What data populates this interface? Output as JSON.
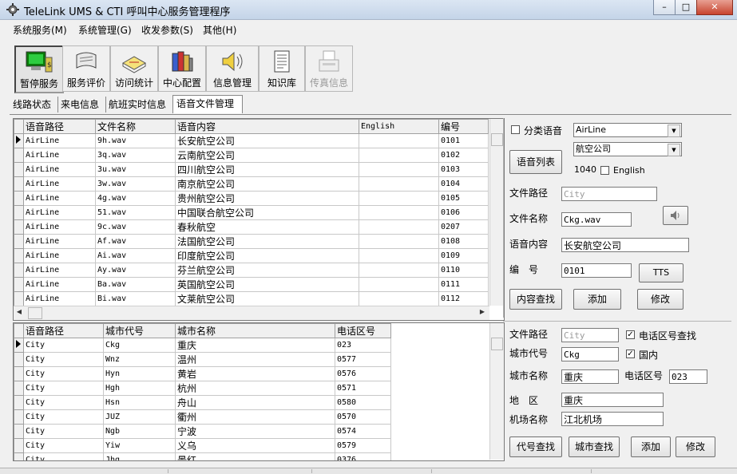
{
  "window": {
    "title": "TeleLink UMS & CTI 呼叫中心服务管理程序",
    "minimize": "–",
    "maximize": "□",
    "close": "✕"
  },
  "menu": [
    "系统服务(M)",
    "系统管理(G)",
    "收发参数(S)",
    "其他(H)"
  ],
  "toolbar": [
    {
      "label": "暂停服务",
      "icon": "computer-server-icon"
    },
    {
      "label": "服务评价",
      "icon": "scroll-icon"
    },
    {
      "label": "访问统计",
      "icon": "book-statistics-icon"
    },
    {
      "label": "中心配置",
      "icon": "config-books-icon"
    },
    {
      "label": "信息管理",
      "icon": "speaker-icon"
    },
    {
      "label": "知识库",
      "icon": "document-icon"
    },
    {
      "label": "传真信息",
      "icon": "fax-icon"
    }
  ],
  "tabs": [
    "线路状态",
    "来电信息",
    "航班实时信息",
    "语音文件管理"
  ],
  "voice_grid": {
    "headers": [
      "语音路径",
      "文件名称",
      "语音内容",
      "English",
      "编号"
    ],
    "rows": [
      [
        "AirLine",
        "9h.wav",
        "长安航空公司",
        "",
        "0101"
      ],
      [
        "AirLine",
        "3q.wav",
        "云南航空公司",
        "",
        "0102"
      ],
      [
        "AirLine",
        "3u.wav",
        "四川航空公司",
        "",
        "0103"
      ],
      [
        "AirLine",
        "3w.wav",
        "南京航空公司",
        "",
        "0104"
      ],
      [
        "AirLine",
        "4g.wav",
        "贵州航空公司",
        "",
        "0105"
      ],
      [
        "AirLine",
        "51.wav",
        "中国联合航空公司",
        "",
        "0106"
      ],
      [
        "AirLine",
        "9c.wav",
        "春秋航空",
        "",
        "0207"
      ],
      [
        "AirLine",
        "Af.wav",
        "法国航空公司",
        "",
        "0108"
      ],
      [
        "AirLine",
        "Ai.wav",
        "印度航空公司",
        "",
        "0109"
      ],
      [
        "AirLine",
        "Ay.wav",
        "芬兰航空公司",
        "",
        "0110"
      ],
      [
        "AirLine",
        "Ba.wav",
        "英国航空公司",
        "",
        "0111"
      ],
      [
        "AirLine",
        "Bi.wav",
        "文莱航空公司",
        "",
        "0112"
      ]
    ]
  },
  "city_grid": {
    "headers": [
      "语音路径",
      "城市代号",
      "城市名称",
      "电话区号"
    ],
    "rows": [
      [
        "City",
        "Ckg",
        "重庆",
        "023"
      ],
      [
        "City",
        "Wnz",
        "温州",
        "0577"
      ],
      [
        "City",
        "Hyn",
        "黄岩",
        "0576"
      ],
      [
        "City",
        "Hgh",
        "杭州",
        "0571"
      ],
      [
        "City",
        "Hsn",
        "舟山",
        "0580"
      ],
      [
        "City",
        "JUZ",
        "衢州",
        "0570"
      ],
      [
        "City",
        "Ngb",
        "宁波",
        "0574"
      ],
      [
        "City",
        "Yiw",
        "义乌",
        "0579"
      ],
      [
        "City",
        "Jhg",
        "景红",
        "0376"
      ]
    ]
  },
  "voice_panel": {
    "classify_label": "分类语音",
    "category_combo": "AirLine",
    "subcategory_combo": "航空公司",
    "list_button": "语音列表",
    "count": "1040",
    "english_label": "English",
    "path_label": "文件路径",
    "path_placeholder": "City",
    "filename_label": "文件名称",
    "filename_value": "Ckg.wav",
    "content_label": "语音内容",
    "content_value": "长安航空公司",
    "number_label": "编　号",
    "number_value": "0101",
    "tts_button": "TTS",
    "search_button": "内容查找",
    "add_button": "添加",
    "edit_button": "修改"
  },
  "city_panel": {
    "path_label": "文件路径",
    "path_value": "City",
    "areacode_search_label": "电话区号查找",
    "code_label": "城市代号",
    "code_value": "Ckg",
    "domestic_label": "国内",
    "name_label": "城市名称",
    "name_value": "重庆",
    "areacode_label": "电话区号",
    "areacode_value": "023",
    "region_label": "地　区",
    "region_value": "重庆",
    "airport_label": "机场名称",
    "airport_value": "江北机场",
    "code_search_button": "代号查找",
    "city_search_button": "城市查找",
    "add_button": "添加",
    "edit_button": "修改"
  }
}
